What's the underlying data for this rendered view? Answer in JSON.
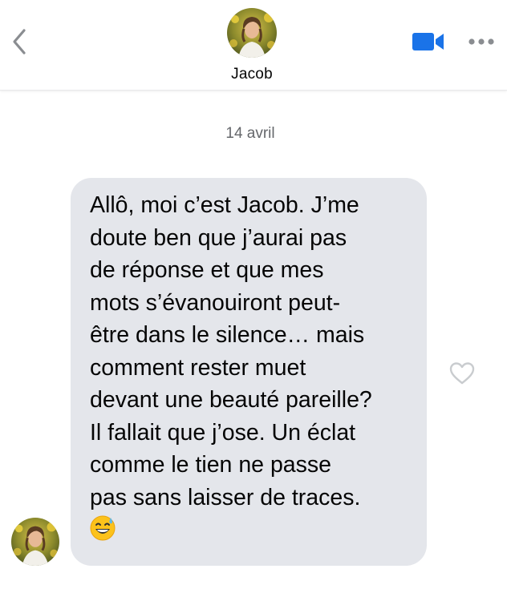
{
  "header": {
    "back_icon": "chevron-left-icon",
    "contact_name": "Jacob",
    "video_icon": "video-camera-icon",
    "more_icon": "more-horizontal-icon"
  },
  "conversation": {
    "date_label": "14 avril",
    "message": {
      "lines": [
        "Allô, moi c’est Jacob. J’me",
        "doute ben que j’aurai pas",
        "de réponse et que mes",
        "mots s’évanouiront peut-",
        "être dans le silence… mais",
        "comment rester muet",
        "devant une beauté pareille?",
        "Il fallait que j’ose. Un éclat",
        "comme le tien ne passe",
        "pas sans laisser de traces."
      ],
      "emoji": "grinning-face-with-sweat-emoji",
      "like_icon": "heart-outline-icon"
    }
  },
  "colors": {
    "accent": "#1a73e8",
    "bubble": "#e4e6eb",
    "icon_gray": "#8a8d91",
    "secondary_text": "#65676b"
  }
}
